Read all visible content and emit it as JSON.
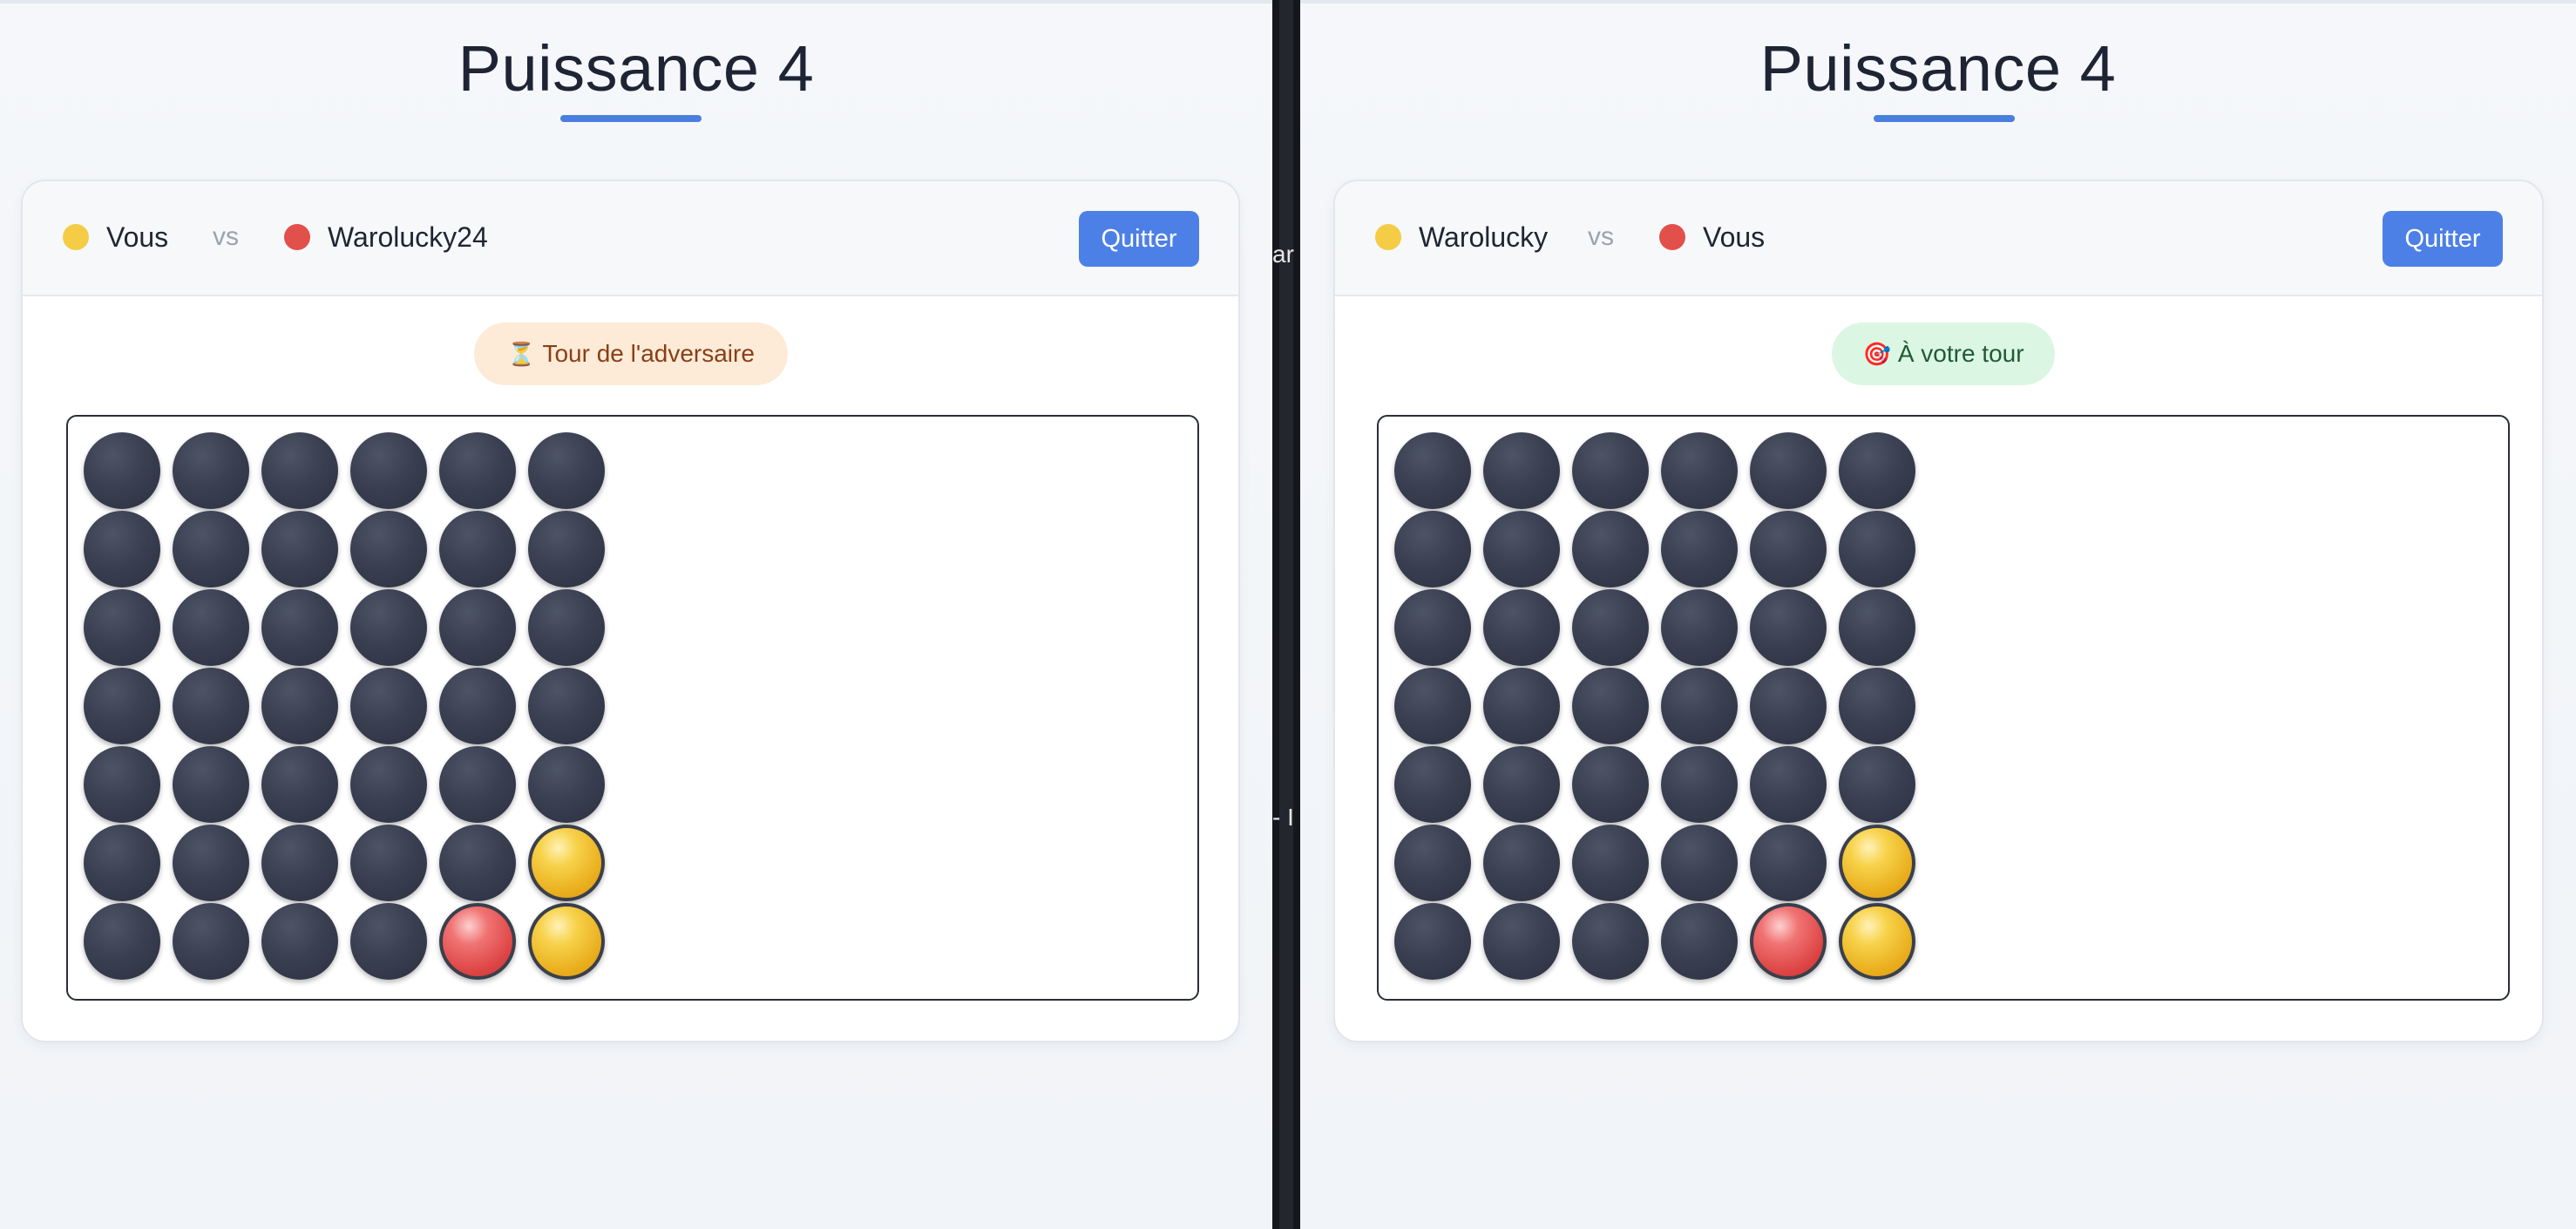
{
  "colors": {
    "accent": "#4d80e6",
    "yellow_disc": "#f4cc45",
    "red_disc": "#e2504b",
    "empty_cell": "#3a4052"
  },
  "left": {
    "title": "Puissance 4",
    "player1": {
      "name": "Vous",
      "color": "yellow"
    },
    "vs": "vs",
    "player2": {
      "name": "Warolucky24",
      "color": "red"
    },
    "quit_label": "Quitter",
    "status_icon": "⏳",
    "status_icon_name": "hourglass-icon",
    "status_text": "Tour de l'adversaire",
    "board": [
      [
        "empty",
        "empty",
        "empty",
        "empty",
        "empty",
        "empty"
      ],
      [
        "empty",
        "empty",
        "empty",
        "empty",
        "empty",
        "empty"
      ],
      [
        "empty",
        "empty",
        "empty",
        "empty",
        "empty",
        "empty"
      ],
      [
        "empty",
        "empty",
        "empty",
        "empty",
        "empty",
        "empty"
      ],
      [
        "empty",
        "empty",
        "empty",
        "empty",
        "empty",
        "empty"
      ],
      [
        "empty",
        "empty",
        "empty",
        "empty",
        "empty",
        "yellow"
      ],
      [
        "empty",
        "empty",
        "empty",
        "empty",
        "red",
        "yellow"
      ]
    ]
  },
  "right": {
    "title": "Puissance 4",
    "player1": {
      "name": "Warolucky",
      "color": "yellow"
    },
    "vs": "vs",
    "player2": {
      "name": "Vous",
      "color": "red"
    },
    "quit_label": "Quitter",
    "status_icon": "🎯",
    "status_icon_name": "target-icon",
    "status_text": "À votre tour",
    "board": [
      [
        "empty",
        "empty",
        "empty",
        "empty",
        "empty",
        "empty"
      ],
      [
        "empty",
        "empty",
        "empty",
        "empty",
        "empty",
        "empty"
      ],
      [
        "empty",
        "empty",
        "empty",
        "empty",
        "empty",
        "empty"
      ],
      [
        "empty",
        "empty",
        "empty",
        "empty",
        "empty",
        "empty"
      ],
      [
        "empty",
        "empty",
        "empty",
        "empty",
        "empty",
        "empty"
      ],
      [
        "empty",
        "empty",
        "empty",
        "empty",
        "empty",
        "yellow"
      ],
      [
        "empty",
        "empty",
        "empty",
        "empty",
        "red",
        "yellow"
      ]
    ]
  },
  "divider": {
    "fragment1": "ar",
    "fragment2": "- I"
  }
}
